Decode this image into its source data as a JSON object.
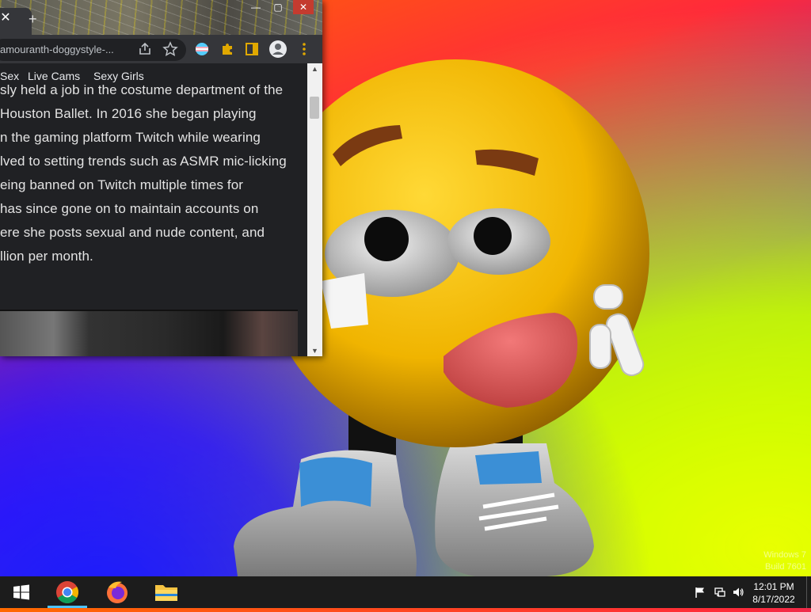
{
  "browser": {
    "address_bar": {
      "url_text": "amouranth-doggystyle-..."
    },
    "toolbar_icons": [
      "share-icon",
      "star-icon",
      "profile-flag-icon",
      "extensions-icon",
      "side-panel-icon",
      "avatar-icon",
      "menu-icon"
    ],
    "window_controls": {
      "minimize": "—",
      "maximize": "▢",
      "close": "✕"
    },
    "tab": {
      "close_glyph": "✕",
      "new_tab_glyph": "+"
    }
  },
  "page": {
    "nav_links": [
      "Sex",
      "Live Cams",
      "Sexy Girls"
    ],
    "article_lines": [
      "sly held a job in the costume department of the",
      "Houston Ballet. In 2016 she began playing",
      "n the gaming platform Twitch while wearing",
      "lved to setting trends such as ASMR mic-licking",
      "eing banned on Twitch multiple times for",
      "has since gone on to maintain accounts on",
      "ere she posts sexual and nude content, and",
      "llion per month."
    ]
  },
  "taskbar": {
    "pinned": [
      "windows-start-icon",
      "chrome-icon",
      "firefox-icon",
      "file-explorer-icon"
    ],
    "tray": [
      "flag-icon",
      "network-icon",
      "volume-icon"
    ],
    "clock": {
      "time": "12:01 PM",
      "date": "8/17/2022"
    }
  },
  "desktop": {
    "watermark": [
      "Windows 7",
      "Build 7601"
    ]
  }
}
